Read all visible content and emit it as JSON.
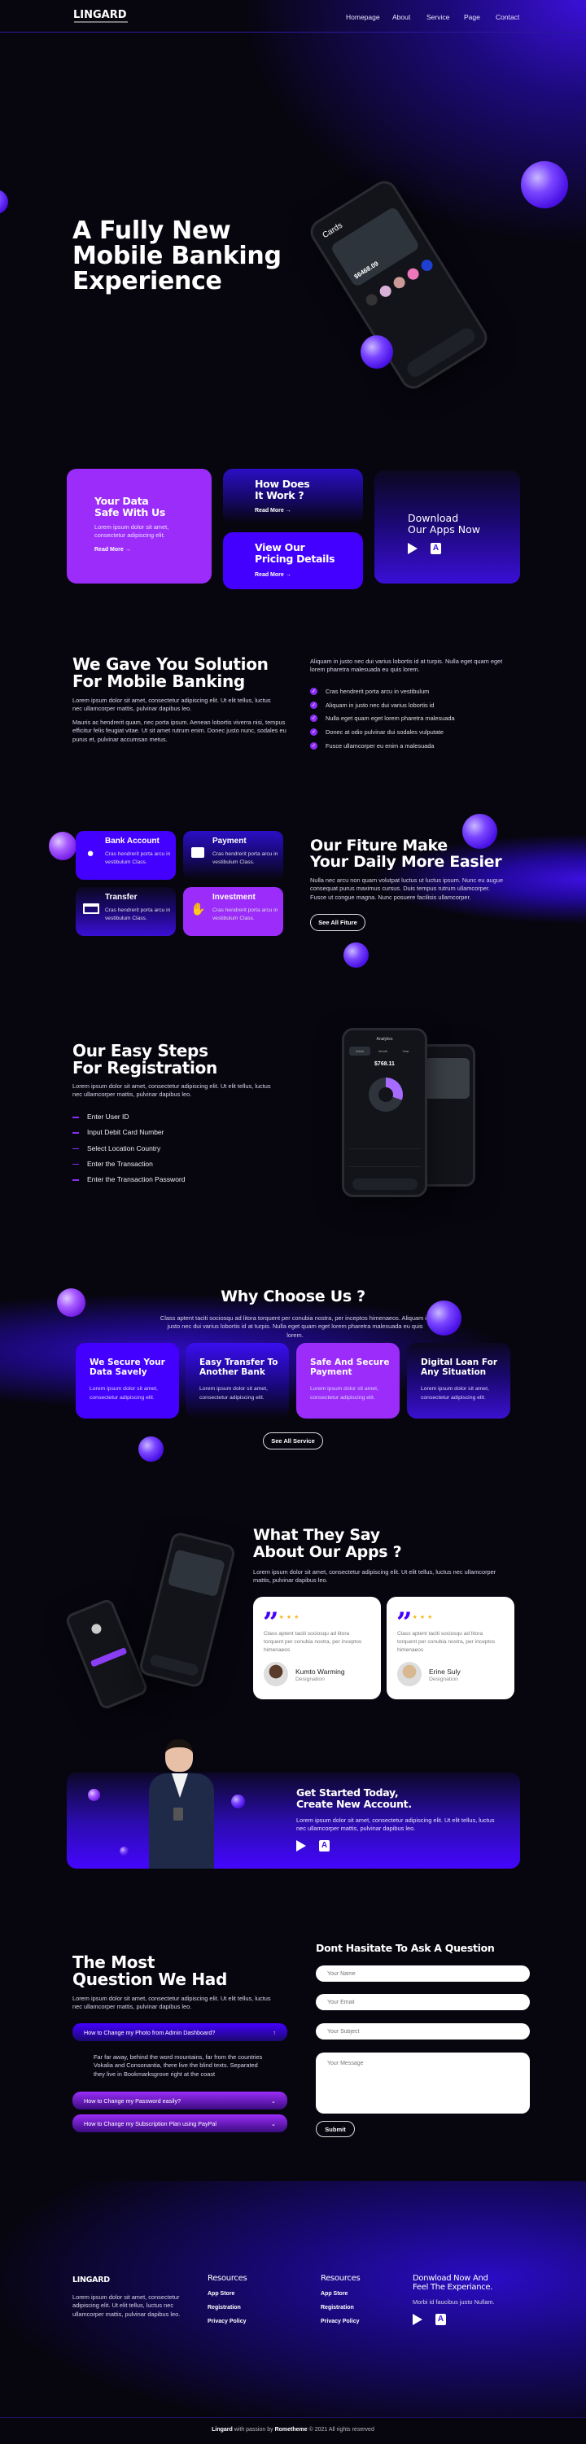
{
  "colors": {
    "purple": "#9b2cfa",
    "blue": "#4400ff",
    "background": "#07060f"
  },
  "header": {
    "logo": "LINGARD",
    "nav": [
      "Homepage",
      "About",
      "Service",
      "Page",
      "Contact"
    ]
  },
  "hero": {
    "title_lines": [
      "A Fully New",
      "Mobile Banking",
      "Experience"
    ],
    "phone": {
      "screen_title": "Cards",
      "balance": "$6468.09"
    }
  },
  "features": [
    {
      "title": [
        "Your Data",
        "Safe With Us"
      ],
      "desc": "Lorem ipsum dolor sit amet, consectetur adipiscing elit.",
      "link": "Read More →"
    },
    {
      "title": [
        "How Does",
        "It Work ?"
      ],
      "link": "Read More →"
    },
    {
      "title": [
        "View Our",
        "Pricing Details"
      ],
      "link": "Read More →"
    },
    {
      "title": [
        "Download",
        "Our Apps Now"
      ],
      "icons": [
        "google-play-icon",
        "app-store-icon"
      ]
    }
  ],
  "solution": {
    "title": [
      "We Gave You Solution",
      "For Mobile Banking"
    ],
    "p1": "Lorem ipsum dolor sit amet, consectetur adipiscing elit. Ut elit tellus, luctus nec ullamcorper mattis, pulvinar dapibus leo.",
    "p2": "Mauris ac hendrerit quam, nec porta ipsum. Aenean lobortis viverra nisi, tempus efficitur felis feugiat vitae. Ut sit amet rutrum enim. Donec justo nunc, sodales eu purus et, pulvinar accumsan metus.",
    "right_text": "Aliquam in justo nec dui varius lobortis id at turpis. Nulla eget quam eget lorem pharetra malesuada eu quis lorem.",
    "checks": [
      "Cras hendrerit porta arcu in vestibulum",
      "Aliquam in justo nec dui varius lobortis id",
      "Nulla eget quam eget lorem pharetra malesuada",
      "Donec at odio pulvinar dui sodales vulputate",
      "Fusce ullamcorper eu enim a malesuada"
    ]
  },
  "services": {
    "items": [
      {
        "title": "Bank Account",
        "desc": "Cras hendrerit porta arcu in vestibulum Class.",
        "icon": "user-icon"
      },
      {
        "title": "Payment",
        "desc": "Cras hendrerit porta arcu in vestibulum Class.",
        "icon": "wallet-icon"
      },
      {
        "title": "Transfer",
        "desc": "Cras hendrerit porta arcu in vestibulum Class.",
        "icon": "credit-card-icon"
      },
      {
        "title": "Investment",
        "desc": "Cras hendrerit porta arcu in vestibulum Class.",
        "icon": "handshake-icon"
      }
    ],
    "title": [
      "Our Fiture Make",
      "Your Daily More Easier"
    ],
    "desc": "Nulla nec arcu non quam volutpat luctus ut luctus ipsum. Nunc eu augue consequat purus maximus cursus. Duis tempus rutrum ullamcorper. Fusce ut congue magna. Nunc posuere facilisis ullamcorper.",
    "button": "See All Fiture"
  },
  "steps": {
    "title": [
      "Our Easy Steps",
      "For Registration"
    ],
    "desc": "Lorem ipsum dolor sit amet, consectetur adipiscing elit. Ut elit tellus, luctus nec ullamcorper mattis, pulvinar dapibus leo.",
    "items": [
      "Enter User ID",
      "Input Debit Card Number",
      "Select Location Country",
      "Enter the Transaction",
      "Enter the Transaction Password"
    ],
    "phone": {
      "screen_title": "Analytics",
      "tabs": [
        "Week",
        "Month",
        "Year"
      ],
      "amount": "$768.11"
    }
  },
  "why": {
    "title": "Why Choose Us ?",
    "desc": "Class aptent taciti sociosqu ad litora torquent per conubia nostra, per inceptos himenaeos. Aliquam in justo nec dui varius lobortis id at turpis. Nulla eget quam eget lorem pharetra malesuada eu quis lorem.",
    "cards": [
      {
        "title": [
          "We Secure Your",
          "Data Savely"
        ],
        "desc": "Lorem ipsum dolor sit amet, consectetur adipiscing elit."
      },
      {
        "title": [
          "Easy Transfer To",
          "Another Bank"
        ],
        "desc": "Lorem ipsum dolor sit amet, consectetur adipiscing elit."
      },
      {
        "title": [
          "Safe And Secure",
          "Payment"
        ],
        "desc": "Lorem ipsum dolor sit amet, consectetur adipiscing elit."
      },
      {
        "title": [
          "Digital Loan For",
          "Any Situation"
        ],
        "desc": "Lorem ipsum dolor sit amet, consectetur adipiscing elit."
      }
    ],
    "button": "See All Service"
  },
  "testimonials": {
    "title": [
      "What They Say",
      "About Our Apps ?"
    ],
    "desc": "Lorem ipsum dolor sit amet, consectetur adipiscing elit. Ut elit tellus, luctus nec ullamcorper mattis, pulvinar dapibus leo.",
    "items": [
      {
        "rating": 5,
        "text": "Class aptent taciti sociosqu ad litora torquent per conubia nostra, per inceptos himenaeos",
        "name": "Kumto Warming",
        "role": "Designation"
      },
      {
        "rating": 5,
        "text": "Class aptent taciti sociosqu ad litora torquent per conubia nostra, per inceptos himenaeos",
        "name": "Erine Suly",
        "role": "Designation"
      }
    ]
  },
  "cta": {
    "title": [
      "Get Started Today,",
      "Create New Account."
    ],
    "desc": "Lorem ipsum dolor sit amet, consectetur adipiscing elit. Ut elit tellus, luctus nec ullamcorper mattis, pulvinar dapibus leo."
  },
  "faq": {
    "title": [
      "The Most",
      "Question We Had"
    ],
    "desc": "Lorem ipsum dolor sit amet, consectetur adipiscing elit. Ut elit tellus, luctus nec ullamcorper mattis, pulvinar dapibus leo.",
    "items": [
      {
        "q": "How to Change my Photo from Admin Dashboard?",
        "a": "Far far away, behind the word mountains, far from the countries Vokalia and Consonantia, there live the blind texts. Separated they live in Bookmarksgrove right at the coast",
        "open": true
      },
      {
        "q": "How to Change my Password easily?",
        "open": false
      },
      {
        "q": "How to Change my Subscription Plan using PayPal",
        "open": false
      }
    ]
  },
  "contact": {
    "title": "Dont Hasitate To Ask A Question",
    "name_ph": "Your Name",
    "email_ph": "Your Email",
    "subject_ph": "Your Subject",
    "message_ph": "Your Message",
    "submit": "Submit"
  },
  "footer": {
    "logo": "LINGARD",
    "about": "Lorem ipsum dolor sit amet, consectetur adipiscing elit. Ut elit tellus, luctus nec ullamcorper mattis, pulvinar dapibus leo.",
    "col1": {
      "title": "Resources",
      "links": [
        "App Store",
        "Registration",
        "Privacy Policy"
      ]
    },
    "col2": {
      "title": "Resources",
      "links": [
        "App Store",
        "Registration",
        "Privacy Policy"
      ]
    },
    "download": {
      "title": [
        "Donwload Now And",
        "Feel The Experiance."
      ],
      "desc": "Morbi id faucibus justo Nullam."
    },
    "copyright": {
      "brand": "Lingard",
      "mid": " with passion by ",
      "author": "Rometheme",
      "rest": " © 2021 All rights reserved"
    }
  }
}
